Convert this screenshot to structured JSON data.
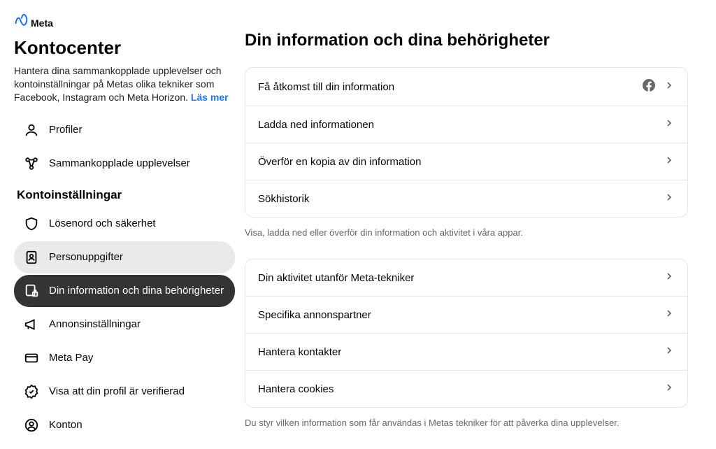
{
  "brand": {
    "name": "Meta"
  },
  "sidebar": {
    "title": "Kontocenter",
    "desc": "Hantera dina sammankopplade upplevelser och kontoinställningar på Metas olika tekniker som Facebook, Instagram och Meta Horizon. ",
    "learn_more": "Läs mer",
    "section_label": "Kontoinställningar",
    "items_top": [
      {
        "label": "Profiler"
      },
      {
        "label": "Sammankopplade upplevelser"
      }
    ],
    "items_settings": [
      {
        "label": "Lösenord och säkerhet"
      },
      {
        "label": "Personuppgifter"
      },
      {
        "label": "Din information och dina behörigheter"
      },
      {
        "label": "Annonsinställningar"
      },
      {
        "label": "Meta Pay"
      },
      {
        "label": "Visa att din profil är verifierad"
      },
      {
        "label": "Konton"
      }
    ]
  },
  "main": {
    "title": "Din information och dina behörigheter",
    "group1": [
      {
        "label": "Få åtkomst till din information",
        "has_fb_icon": true
      },
      {
        "label": "Ladda ned informationen"
      },
      {
        "label": "Överför en kopia av din information"
      },
      {
        "label": "Sökhistorik"
      }
    ],
    "caption1": "Visa, ladda ned eller överför din information och aktivitet i våra appar.",
    "group2": [
      {
        "label": "Din aktivitet utanför Meta-tekniker"
      },
      {
        "label": "Specifika annonspartner"
      },
      {
        "label": "Hantera kontakter"
      },
      {
        "label": "Hantera cookies"
      }
    ],
    "caption2": "Du styr vilken information som får användas i Metas tekniker för att påverka dina upplevelser."
  }
}
